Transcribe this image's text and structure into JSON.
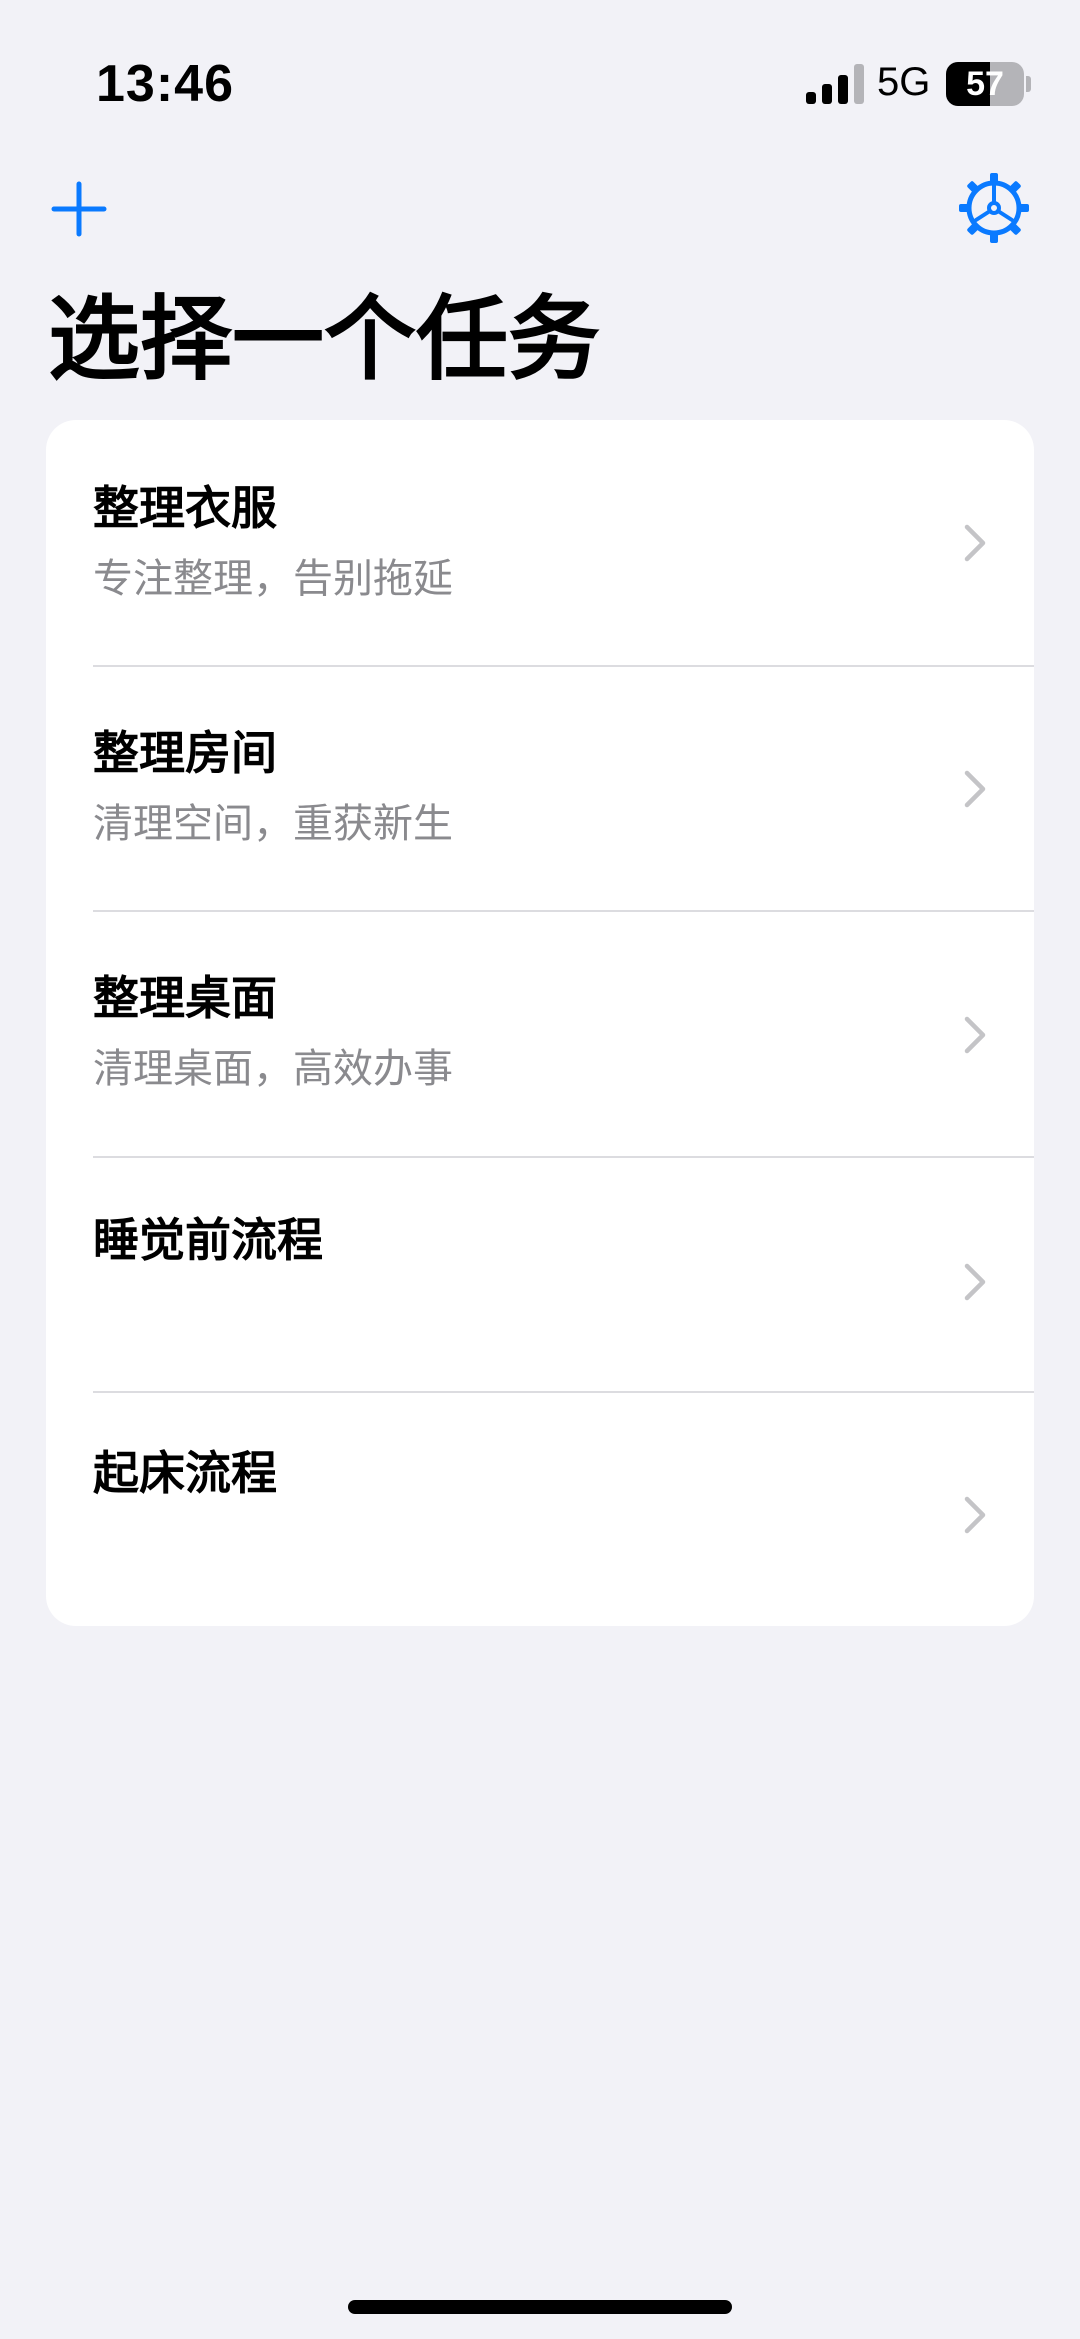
{
  "status_bar": {
    "time": "13:46",
    "network": "5G",
    "battery_level": "57",
    "battery_fraction": 0.57
  },
  "nav": {
    "add_icon": "plus-icon",
    "settings_icon": "gear-icon",
    "accent_color": "#0a7aff"
  },
  "page": {
    "title": "选择一个任务"
  },
  "tasks": [
    {
      "title": "整理衣服",
      "subtitle": "专注整理，告别拖延"
    },
    {
      "title": "整理房间",
      "subtitle": "清理空间，重获新生"
    },
    {
      "title": "整理桌面",
      "subtitle": "清理桌面，高效办事"
    },
    {
      "title": "睡觉前流程",
      "subtitle": ""
    },
    {
      "title": "起床流程",
      "subtitle": ""
    }
  ]
}
